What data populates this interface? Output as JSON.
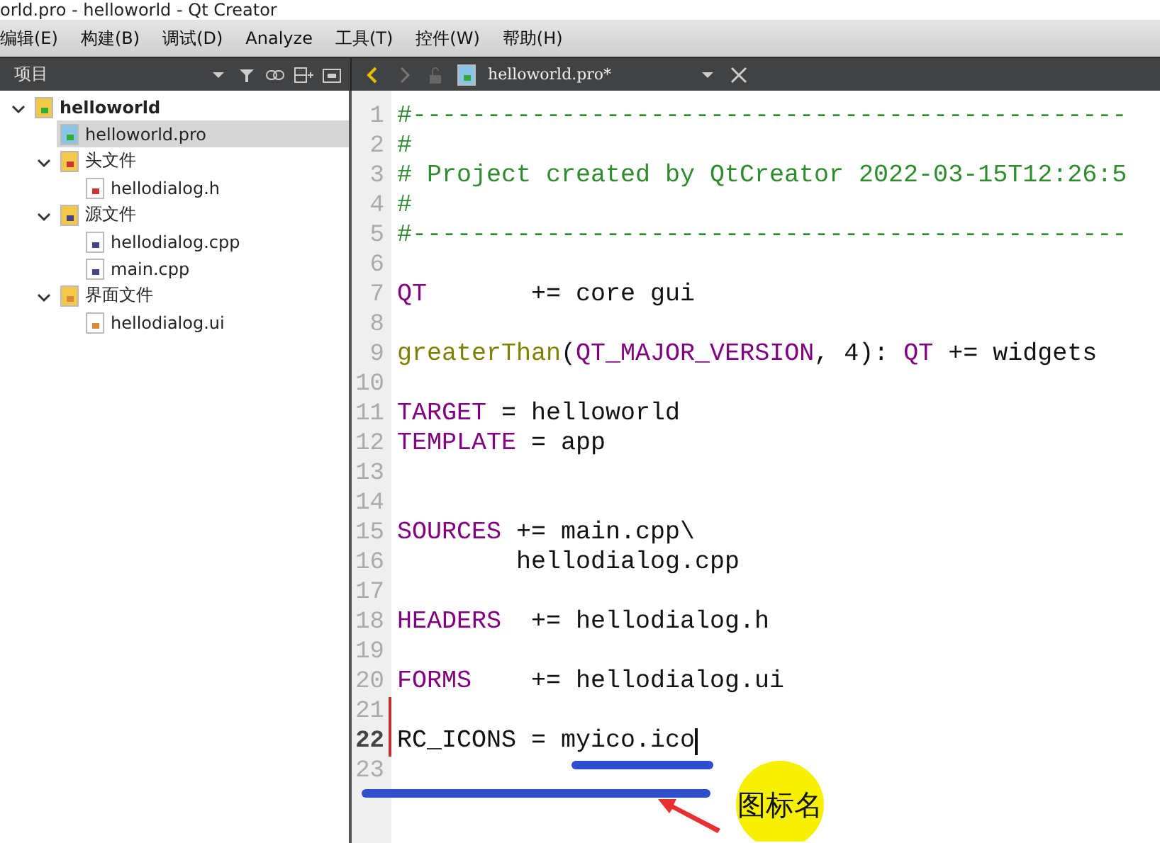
{
  "window": {
    "title": "orld.pro - helloworld - Qt Creator"
  },
  "menu": [
    "编辑(E)",
    "构建(B)",
    "调试(D)",
    "Analyze",
    "工具(T)",
    "控件(W)",
    "帮助(H)"
  ],
  "sidebar": {
    "title": "项目",
    "tree": [
      {
        "label": "helloworld",
        "kind": "project",
        "expanded": true,
        "selected": false,
        "children": [
          {
            "label": "helloworld.pro",
            "kind": "pro",
            "selected": true
          },
          {
            "label": "头文件",
            "kind": "header-folder",
            "expanded": true,
            "selected": false,
            "children": [
              {
                "label": "hellodialog.h",
                "kind": "header",
                "selected": false
              }
            ]
          },
          {
            "label": "源文件",
            "kind": "source-folder",
            "expanded": true,
            "selected": false,
            "children": [
              {
                "label": "hellodialog.cpp",
                "kind": "source",
                "selected": false
              },
              {
                "label": "main.cpp",
                "kind": "source",
                "selected": false
              }
            ]
          },
          {
            "label": "界面文件",
            "kind": "form-folder",
            "expanded": true,
            "selected": false,
            "children": [
              {
                "label": "hellodialog.ui",
                "kind": "form",
                "selected": false
              }
            ]
          }
        ]
      }
    ]
  },
  "editor": {
    "file": "helloworld.pro*",
    "lines": [
      {
        "number": "1",
        "modified": false,
        "current": false,
        "tokens": [
          {
            "kind": "comment",
            "text": "#------------------------------------------------"
          }
        ]
      },
      {
        "number": "2",
        "modified": false,
        "current": false,
        "tokens": [
          {
            "kind": "comment",
            "text": "#"
          }
        ]
      },
      {
        "number": "3",
        "modified": false,
        "current": false,
        "tokens": [
          {
            "kind": "comment",
            "text": "# Project created by QtCreator 2022-03-15T12:26:5"
          }
        ]
      },
      {
        "number": "4",
        "modified": false,
        "current": false,
        "tokens": [
          {
            "kind": "comment",
            "text": "#"
          }
        ]
      },
      {
        "number": "5",
        "modified": false,
        "current": false,
        "tokens": [
          {
            "kind": "comment",
            "text": "#------------------------------------------------"
          }
        ]
      },
      {
        "number": "6",
        "modified": false,
        "current": false
      },
      {
        "number": "7",
        "modified": false,
        "current": false,
        "tokens": [
          {
            "kind": "variable",
            "text": "QT"
          },
          {
            "kind": "plain",
            "text": "       += core gui"
          }
        ]
      },
      {
        "number": "8",
        "modified": false,
        "current": false
      },
      {
        "number": "9",
        "modified": false,
        "current": false,
        "tokens": [
          {
            "kind": "function",
            "text": "greaterThan"
          },
          {
            "kind": "plain",
            "text": "("
          },
          {
            "kind": "variable",
            "text": "QT_MAJOR_VERSION"
          },
          {
            "kind": "plain",
            "text": ", 4): "
          },
          {
            "kind": "variable",
            "text": "QT"
          },
          {
            "kind": "plain",
            "text": " += widgets"
          }
        ]
      },
      {
        "number": "10",
        "modified": false,
        "current": false
      },
      {
        "number": "11",
        "modified": false,
        "current": false,
        "tokens": [
          {
            "kind": "variable",
            "text": "TARGET"
          },
          {
            "kind": "plain",
            "text": " = helloworld"
          }
        ]
      },
      {
        "number": "12",
        "modified": false,
        "current": false,
        "tokens": [
          {
            "kind": "variable",
            "text": "TEMPLATE"
          },
          {
            "kind": "plain",
            "text": " = app"
          }
        ]
      },
      {
        "number": "13",
        "modified": false,
        "current": false
      },
      {
        "number": "14",
        "modified": false,
        "current": false
      },
      {
        "number": "15",
        "modified": false,
        "current": false,
        "tokens": [
          {
            "kind": "variable",
            "text": "SOURCES"
          },
          {
            "kind": "plain",
            "text": " += main.cpp\\"
          }
        ]
      },
      {
        "number": "16",
        "modified": false,
        "current": false,
        "tokens": [
          {
            "kind": "plain",
            "text": "        hellodialog.cpp"
          }
        ]
      },
      {
        "number": "17",
        "modified": false,
        "current": false
      },
      {
        "number": "18",
        "modified": false,
        "current": false,
        "tokens": [
          {
            "kind": "variable",
            "text": "HEADERS"
          },
          {
            "kind": "plain",
            "text": "  += hellodialog.h"
          }
        ]
      },
      {
        "number": "19",
        "modified": false,
        "current": false
      },
      {
        "number": "20",
        "modified": false,
        "current": false,
        "tokens": [
          {
            "kind": "variable",
            "text": "FORMS"
          },
          {
            "kind": "plain",
            "text": "    += hellodialog.ui"
          }
        ]
      },
      {
        "number": "21",
        "modified": true,
        "current": false
      },
      {
        "number": "22",
        "modified": true,
        "current": true,
        "tokens": [
          {
            "kind": "plain",
            "text": "RC_ICONS = myico.ico"
          }
        ]
      },
      {
        "number": "23",
        "modified": false,
        "current": false
      }
    ]
  },
  "annotation": {
    "label": "图标名"
  }
}
